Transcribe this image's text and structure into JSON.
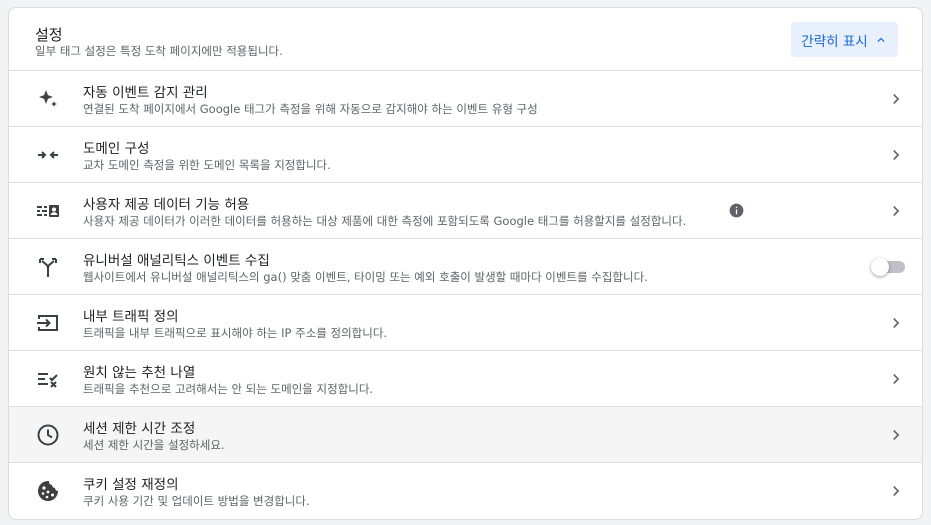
{
  "header": {
    "title": "설정",
    "subtitle": "일부 태그 설정은 특정 도착 페이지에만 적용됩니다.",
    "collapse_label": "간략히 표시"
  },
  "rows": [
    {
      "icon": "sparkle-icon",
      "title": "자동 이벤트 감지 관리",
      "description": "연결된 도착 페이지에서 Google 태그가 측정을 위해 자동으로 감지해야 하는 이벤트 유형 구성"
    },
    {
      "icon": "merge-arrows-icon",
      "title": "도메인 구성",
      "description": "교차 도메인 측정을 위한 도메인 목록을 지정합니다."
    },
    {
      "icon": "user-data-icon",
      "title": "사용자 제공 데이터 기능 허용",
      "description": "사용자 제공 데이터가 이러한 데이터를 허용하는 대상 제품에 대한 측정에 포함되도록 Google 태그를 허용할지를 설정합니다."
    },
    {
      "icon": "fork-icon",
      "title": "유니버설 애널리틱스 이벤트 수집",
      "description": "웹사이트에서 유니버설 애널리틱스의 ga() 맞춤 이벤트, 타이밍 또는 예외 호출이 발생할 때마다 이벤트를 수집합니다.",
      "toggle_on": false
    },
    {
      "icon": "login-icon",
      "title": "내부 트래픽 정의",
      "description": "트래픽을 내부 트래픽으로 표시해야 하는 IP 주소를 정의합니다."
    },
    {
      "icon": "rule-icon",
      "title": "원치 않는 추천 나열",
      "description": "트래픽을 추천으로 고려해서는 안 되는 도메인을 지정합니다."
    },
    {
      "icon": "clock-icon",
      "title": "세션 제한 시간 조정",
      "description": "세션 제한 시간을 설정하세요."
    },
    {
      "icon": "cookie-icon",
      "title": "쿠키 설정 재정의",
      "description": "쿠키 사용 기간 및 업데이트 방법을 변경합니다."
    }
  ],
  "colors": {
    "accent": "#1967d2",
    "accent_bg": "#e8f0fe",
    "icon": "#3c4043",
    "toggle_off_track": "#bdc1c6"
  }
}
